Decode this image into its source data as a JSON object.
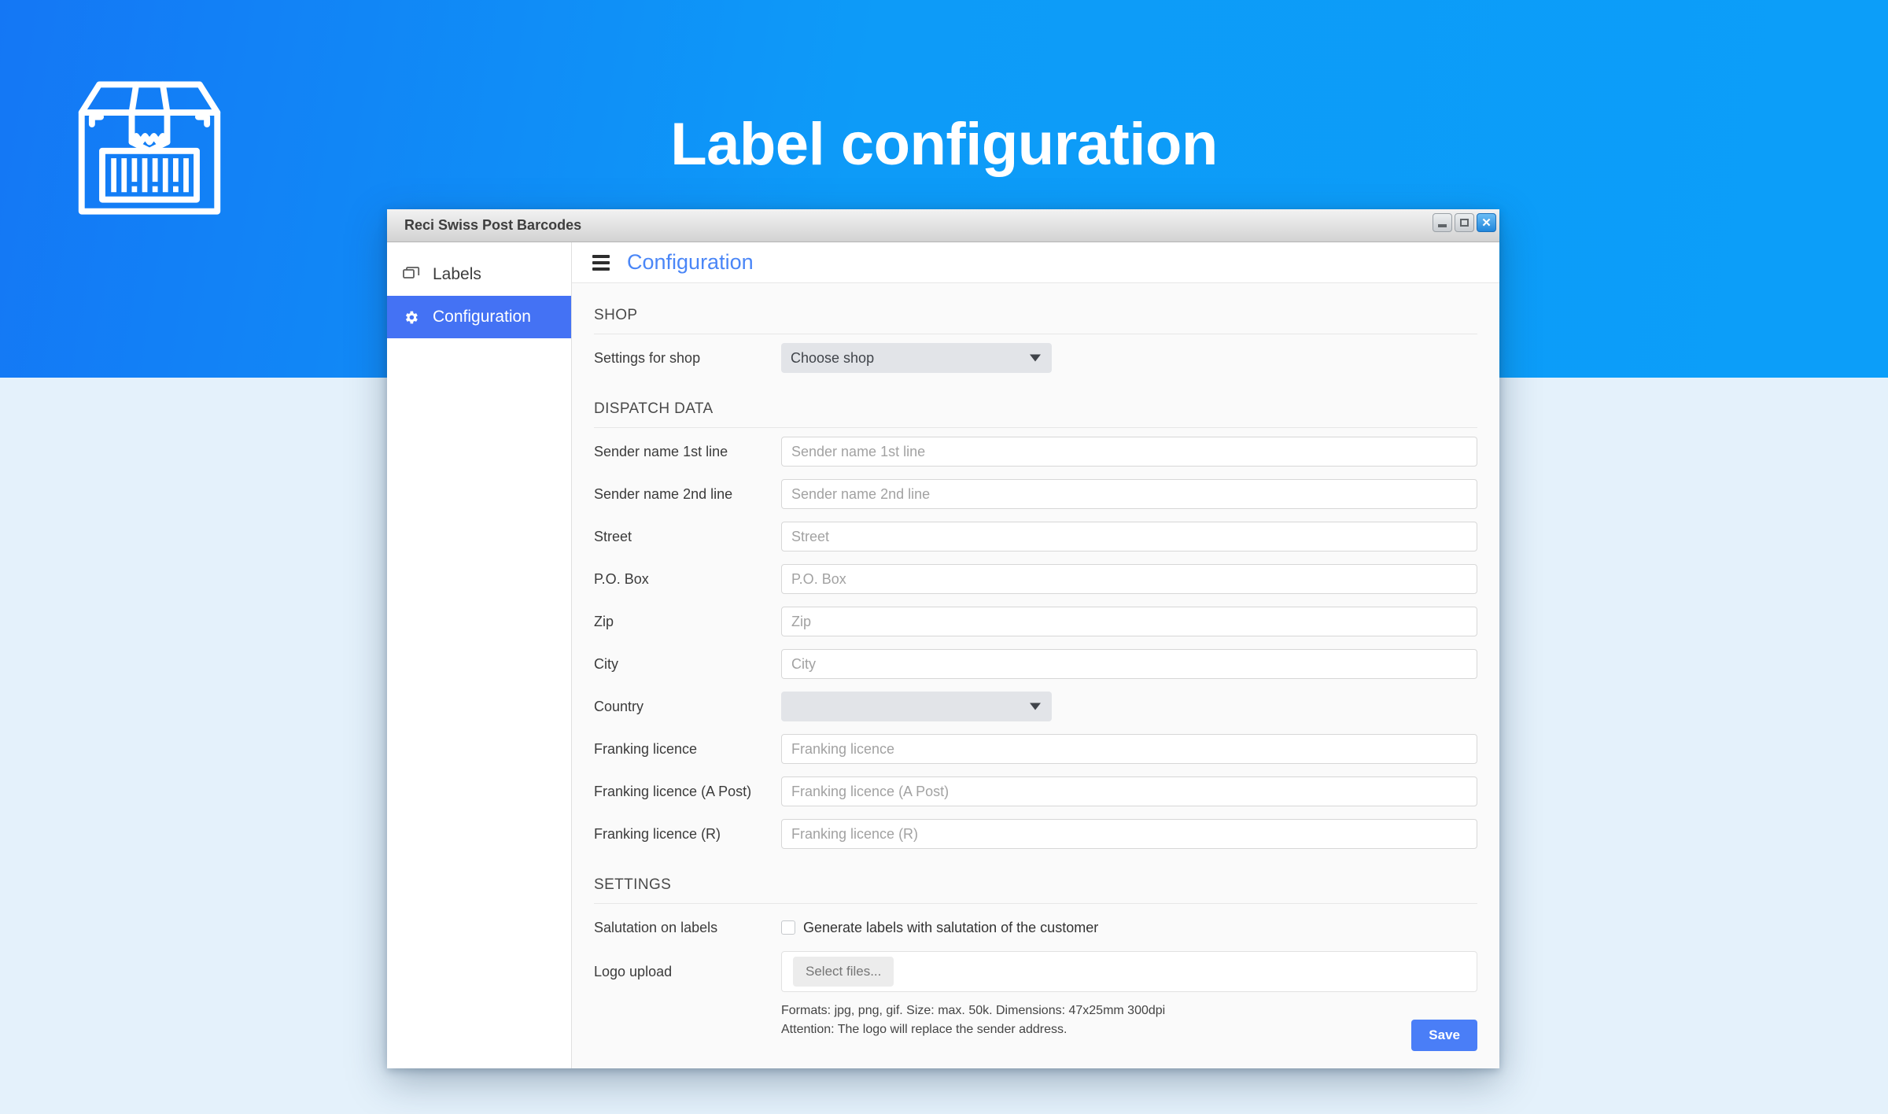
{
  "hero": {
    "title": "Label configuration",
    "logo_icon": "package-barcode-icon",
    "banner_color": "#0c9ef9"
  },
  "window": {
    "title": "Reci Swiss Post Barcodes",
    "controls": {
      "minimize": "minimize-button",
      "maximize": "maximize-button",
      "close": "✕"
    }
  },
  "sidebar": {
    "items": [
      {
        "label": "Labels",
        "icon": "copy-icon",
        "active": false
      },
      {
        "label": "Configuration",
        "icon": "gear-icon",
        "active": true
      }
    ]
  },
  "header": {
    "menu_icon": "hamburger-icon",
    "title": "Configuration",
    "title_color": "#4a86f7"
  },
  "sections": {
    "shop": {
      "heading": "SHOP",
      "settings_for_shop": {
        "label": "Settings for shop",
        "value": "Choose shop"
      }
    },
    "dispatch": {
      "heading": "DISPATCH DATA",
      "fields": [
        {
          "label": "Sender name 1st line",
          "placeholder": "Sender name 1st line",
          "value": "",
          "type": "text"
        },
        {
          "label": "Sender name 2nd line",
          "placeholder": "Sender name 2nd line",
          "value": "",
          "type": "text"
        },
        {
          "label": "Street",
          "placeholder": "Street",
          "value": "",
          "type": "text"
        },
        {
          "label": "P.O. Box",
          "placeholder": "P.O. Box",
          "value": "",
          "type": "text"
        },
        {
          "label": "Zip",
          "placeholder": "Zip",
          "value": "",
          "type": "text"
        },
        {
          "label": "City",
          "placeholder": "City",
          "value": "",
          "type": "text"
        },
        {
          "label": "Country",
          "placeholder": "",
          "value": "",
          "type": "select"
        },
        {
          "label": "Franking licence",
          "placeholder": "Franking licence",
          "value": "",
          "type": "text"
        },
        {
          "label": "Franking licence (A Post)",
          "placeholder": "Franking licence (A Post)",
          "value": "",
          "type": "text"
        },
        {
          "label": "Franking licence (R)",
          "placeholder": "Franking licence (R)",
          "value": "",
          "type": "text"
        }
      ]
    },
    "settings": {
      "heading": "SETTINGS",
      "salutation": {
        "label": "Salutation on labels",
        "checkbox_text": "Generate labels with salutation of the customer",
        "checked": false
      },
      "logo_upload": {
        "label": "Logo upload",
        "button": "Select files...",
        "help_line_1": "Formats: jpg, png, gif. Size: max. 50k. Dimensions: 47x25mm 300dpi",
        "help_line_2": "Attention: The logo will replace the sender address."
      }
    }
  },
  "footer": {
    "save_label": "Save",
    "save_color": "#4a7ef7"
  }
}
